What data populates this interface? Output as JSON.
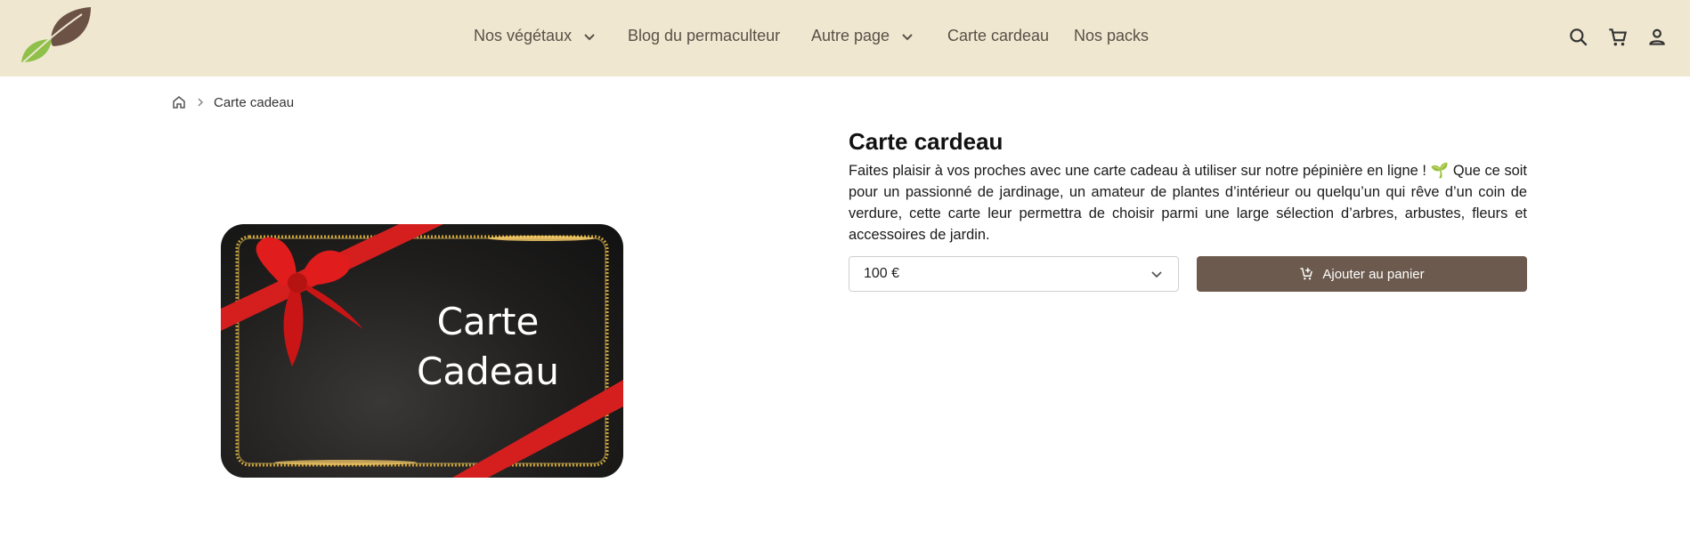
{
  "header": {
    "nav": [
      {
        "label": "Nos végétaux",
        "has_dropdown": true
      },
      {
        "label": "Blog du permaculteur",
        "has_dropdown": false
      },
      {
        "label": "Autre page",
        "has_dropdown": true
      },
      {
        "label": "Carte cardeau",
        "has_dropdown": false
      },
      {
        "label": "Nos packs",
        "has_dropdown": false
      }
    ],
    "icons": [
      "search-icon",
      "cart-icon",
      "account-icon"
    ]
  },
  "breadcrumb": {
    "current": "Carte cadeau"
  },
  "product": {
    "image_text_line1": "Carte",
    "image_text_line2": "Cadeau",
    "title": "Carte cardeau",
    "description": "Faites plaisir à vos proches avec une carte cadeau à utiliser sur notre pépinière en ligne ! 🌱 Que ce soit pour un passionné de jardinage, un amateur de plantes d’intérieur ou quelqu’un qui rêve d’un coin de verdure, cette carte leur permettra de choisir parmi une large sélection d’arbres, arbustes, fleurs et accessoires de jardin.",
    "selected_amount": "100 €",
    "add_to_cart_label": "Ajouter au panier"
  },
  "colors": {
    "header_bg": "#efe7d0",
    "nav_text": "#5a5047",
    "button_bg": "#6b5a4d",
    "logo_brown": "#6b5244",
    "logo_green": "#8fc04a"
  }
}
